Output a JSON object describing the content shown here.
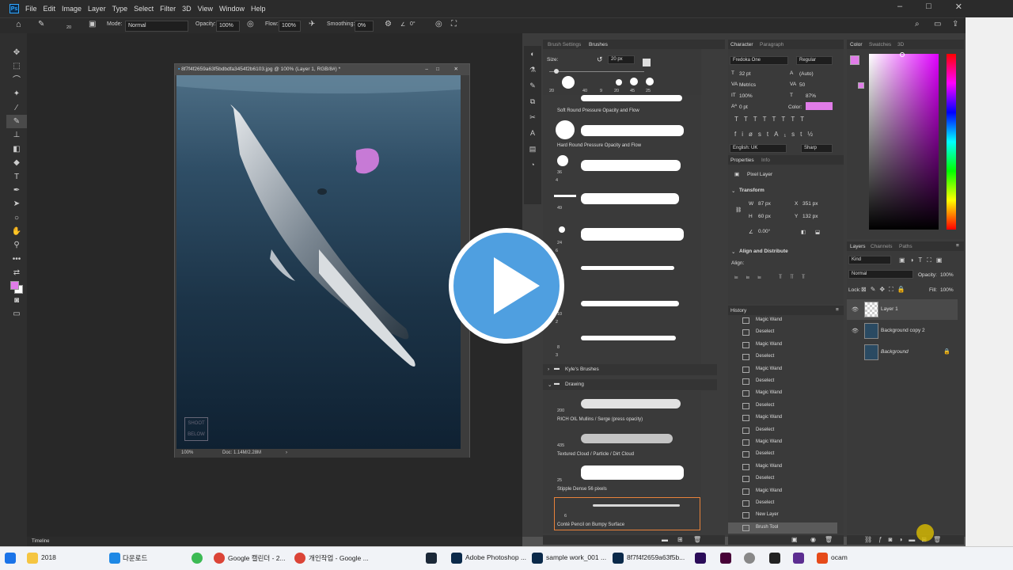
{
  "menubar": {
    "app_icon": "Ps",
    "items": [
      "File",
      "Edit",
      "Image",
      "Layer",
      "Type",
      "Select",
      "Filter",
      "3D",
      "View",
      "Window",
      "Help"
    ]
  },
  "options": {
    "brush_size": "20",
    "mode_label": "Mode:",
    "mode_value": "Normal",
    "opacity_label": "Opacity:",
    "opacity_value": "100%",
    "flow_label": "Flow:",
    "flow_value": "100%",
    "smoothing_label": "Smoothing:",
    "smoothing_value": "0%",
    "angle_value": "0°"
  },
  "document": {
    "title": "8f7f4f2659a63f5bdbdfa3454f2b6103.jpg @ 100% (Layer 1, RGB/8#) *",
    "zoom": "100%",
    "doc_size": "Doc: 1.14M/2.28M",
    "watermark_lines": [
      "SHOOT",
      "BELOW"
    ]
  },
  "brush_panel": {
    "tabs": [
      "Brush Settings",
      "Brushes"
    ],
    "size_label": "Size:",
    "size_value": "20 px",
    "presets": [
      "20",
      "40",
      "9",
      "20",
      "45",
      "25"
    ],
    "brushes": [
      {
        "name": "Soft Round Pressure Opacity and Flow"
      },
      {
        "name": "Hard Round Pressure Opacity and Flow"
      },
      {
        "name": "",
        "num": "36"
      },
      {
        "name": "",
        "num": "49"
      },
      {
        "name": "",
        "num": "24"
      },
      {
        "name": "",
        "num": "6"
      },
      {
        "name": "",
        "num": "10"
      },
      {
        "name": "",
        "num": "8"
      }
    ],
    "side_nums": [
      "4",
      "6",
      "6",
      "2",
      "3"
    ],
    "group1": "Kyle's Brushes",
    "group2": "Drawing",
    "drawing_brushes": [
      {
        "num": "200",
        "name": "RICH OIL Mullins / Serge (press opacity)"
      },
      {
        "num": "435",
        "name": "Textured Cloud / Particle / Dirt Cloud"
      },
      {
        "num": "25",
        "name": "Stipple Dense 56 pixels"
      },
      {
        "num": "6",
        "name": "Conté Pencil on Bumpy Surface"
      }
    ]
  },
  "character": {
    "tabs": [
      "Character",
      "Paragraph"
    ],
    "font": "Fredoka One",
    "style": "Regular",
    "size": "32 pt",
    "leading": "(Auto)",
    "kerning": "Metrics",
    "tracking": "50",
    "vscale": "100%",
    "hscale": "87%",
    "baseline": "0 pt",
    "color_label": "Color:",
    "language": "English: UK",
    "aa": "Sharp",
    "color": "#e07ce8"
  },
  "properties": {
    "tabs": [
      "Properties",
      "Info"
    ],
    "kind": "Pixel Layer",
    "transform": "Transform",
    "w": "87 px",
    "x": "351 px",
    "h": "60 px",
    "y": "132 px",
    "angle": "0.00°",
    "align": "Align and Distribute",
    "align_label": "Align:"
  },
  "history": {
    "title": "History",
    "items": [
      "Magic Wand",
      "Deselect",
      "Magic Wand",
      "Deselect",
      "Magic Wand",
      "Deselect",
      "Magic Wand",
      "Deselect",
      "Magic Wand",
      "Deselect",
      "Magic Wand",
      "Deselect",
      "Magic Wand",
      "Deselect",
      "Magic Wand",
      "Deselect",
      "New Layer",
      "Brush Tool"
    ]
  },
  "color_panel": {
    "tabs": [
      "Color",
      "Swatches",
      "3D"
    ],
    "fg": "#e07ce8"
  },
  "layers": {
    "tabs": [
      "Layers",
      "Channels",
      "Paths"
    ],
    "kind": "Kind",
    "blend": "Normal",
    "opacity_label": "Opacity:",
    "opacity": "100%",
    "lock_label": "Lock:",
    "fill_label": "Fill:",
    "fill": "100%",
    "items": [
      "Layer 1",
      "Background copy 2",
      "Background"
    ]
  },
  "timeline": {
    "label": "Timeline"
  },
  "taskbar": {
    "items": [
      "2018",
      "다운로드",
      "Google 캘린더 - 2...",
      "개인작업 - Google ...",
      "Adobe Photoshop ...",
      "sample work_001 ...",
      "8f7f4f2659a63f5b...",
      "ocam"
    ]
  }
}
